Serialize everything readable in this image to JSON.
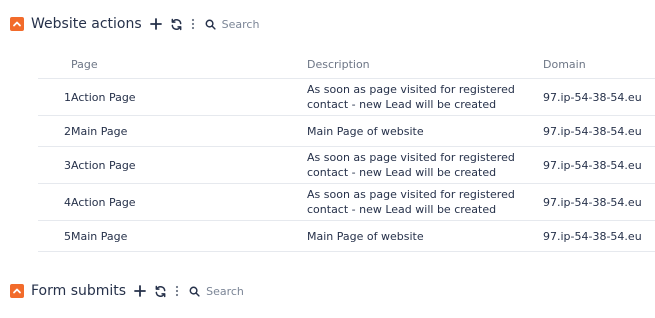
{
  "website_actions": {
    "title": "Website actions",
    "search_placeholder": "Search",
    "columns": {
      "page": "Page",
      "description": "Description",
      "domain": "Domain"
    },
    "rows": [
      {
        "num": "1",
        "page": "Action Page",
        "description": "As soon as page visited for registered contact - new Lead will be created",
        "domain": "97.ip-54-38-54.eu"
      },
      {
        "num": "2",
        "page": "Main Page",
        "description": "Main Page of website",
        "domain": "97.ip-54-38-54.eu"
      },
      {
        "num": "3",
        "page": "Action Page",
        "description": "As soon as page visited for registered contact - new Lead will be created",
        "domain": "97.ip-54-38-54.eu"
      },
      {
        "num": "4",
        "page": "Action Page",
        "description": "As soon as page visited for registered contact - new Lead will be created",
        "domain": "97.ip-54-38-54.eu"
      },
      {
        "num": "5",
        "page": "Main Page",
        "description": "Main Page of website",
        "domain": "97.ip-54-38-54.eu"
      }
    ]
  },
  "form_submits": {
    "title": "Form submits",
    "search_placeholder": "Search"
  },
  "colors": {
    "accent": "#f26b2b",
    "text": "#26314a",
    "muted": "#6d7686",
    "divider": "#e6e9ee"
  },
  "icons": {
    "collapse": "chevron-up-icon",
    "add": "plus-icon",
    "refresh": "refresh-icon",
    "more": "more-vertical-icon",
    "search": "search-icon"
  }
}
